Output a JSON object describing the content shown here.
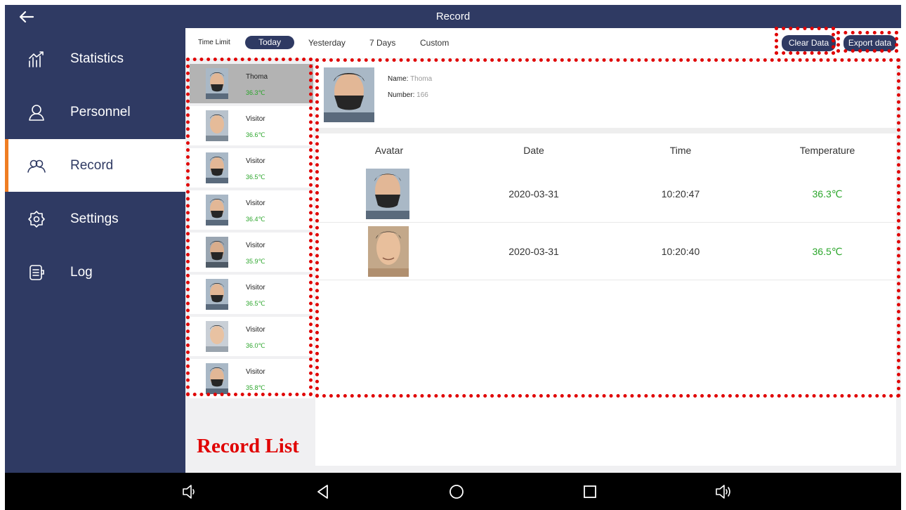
{
  "window": {
    "title": "Record"
  },
  "sidebar": {
    "items": [
      {
        "label": "Statistics",
        "icon": "statistics-icon"
      },
      {
        "label": "Personnel",
        "icon": "person-icon"
      },
      {
        "label": "Record",
        "icon": "group-icon",
        "active": true
      },
      {
        "label": "Settings",
        "icon": "gear-icon"
      },
      {
        "label": "Log",
        "icon": "log-icon"
      }
    ]
  },
  "filter": {
    "label": "Time Limit",
    "options": [
      "Today",
      "Yesterday",
      "7 Days",
      "Custom"
    ],
    "selected": "Today",
    "clear_label": "Clear Data",
    "export_label": "Export data"
  },
  "record_list": [
    {
      "name": "Thoma",
      "temp": "36.3℃"
    },
    {
      "name": "Visitor",
      "temp": "36.6℃"
    },
    {
      "name": "Visitor",
      "temp": "36.5℃"
    },
    {
      "name": "Visitor",
      "temp": "36.4℃"
    },
    {
      "name": "Visitor",
      "temp": "35.9℃"
    },
    {
      "name": "Visitor",
      "temp": "36.5℃"
    },
    {
      "name": "Visitor",
      "temp": "36.0℃"
    },
    {
      "name": "Visitor",
      "temp": "35.8℃"
    }
  ],
  "detail": {
    "name_label": "Name:",
    "name_value": "Thoma",
    "number_label": "Number:",
    "number_value": "166",
    "columns": [
      "Avatar",
      "Date",
      "Time",
      "Temperature"
    ],
    "rows": [
      {
        "date": "2020-03-31",
        "time": "10:20:47",
        "temp": "36.3℃"
      },
      {
        "date": "2020-03-31",
        "time": "10:20:40",
        "temp": "36.5℃"
      }
    ]
  },
  "annotation": {
    "caption": "Record List"
  },
  "colors": {
    "nav_bg": "#2f3a63",
    "accent": "#ef7d22",
    "temp_green": "#2aa52a",
    "highlight": "#e00000"
  }
}
